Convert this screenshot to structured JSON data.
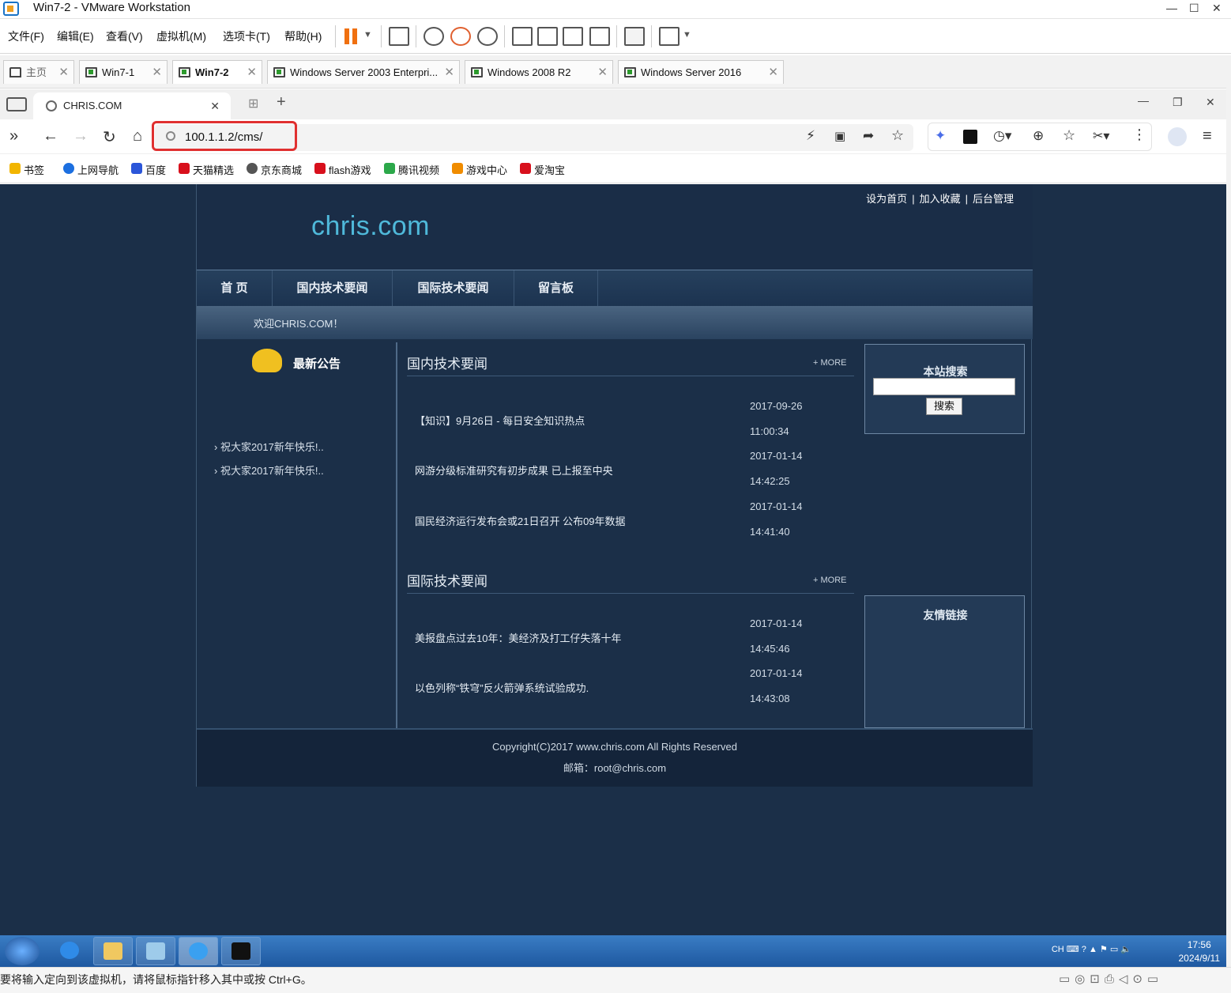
{
  "vmware": {
    "title": "Win7-2 - VMware Workstation",
    "menu": [
      "文件(F)",
      "编辑(E)",
      "查看(V)",
      "虚拟机(M)",
      "选项卡(T)",
      "帮助(H)"
    ],
    "tabs": [
      {
        "label": "主页",
        "icon": "home-icon"
      },
      {
        "label": "Win7-1",
        "icon": "vm-icon"
      },
      {
        "label": "Win7-2",
        "icon": "vm-icon",
        "active": true
      },
      {
        "label": "Windows Server 2003 Enterpri...",
        "icon": "vm-icon"
      },
      {
        "label": "Windows 2008 R2",
        "icon": "vm-icon"
      },
      {
        "label": "Windows Server 2016",
        "icon": "vm-icon"
      }
    ],
    "status_text": "要将输入定向到该虚拟机，请将鼠标指针移入其中或按 Ctrl+G。"
  },
  "browser": {
    "tab_title": "CHRIS.COM",
    "address": "100.1.1.2/cms/",
    "bookmarks": [
      {
        "label": "书签",
        "color": "#f2b500"
      },
      {
        "label": "上网导航",
        "color": "#1c6fe0"
      },
      {
        "label": "百度",
        "color": "#2b56d9"
      },
      {
        "label": "天猫精选",
        "color": "#d8101c"
      },
      {
        "label": "京东商城",
        "color": "#555555"
      },
      {
        "label": "flash游戏",
        "color": "#d8101c"
      },
      {
        "label": "腾讯视频",
        "color": "#2ca84a"
      },
      {
        "label": "游戏中心",
        "color": "#f08c00"
      },
      {
        "label": "爱淘宝",
        "color": "#d8101c"
      }
    ]
  },
  "site": {
    "top_links": [
      "设为首页",
      "加入收藏",
      "后台管理"
    ],
    "logo": "chris.com",
    "nav": [
      "首 页",
      "国内技术要闻",
      "国际技术要闻",
      "留言板"
    ],
    "welcome": "欢迎CHRIS.COM！",
    "announce_title": "最新公告",
    "announcements": [
      "祝大家2017新年快乐!..",
      "祝大家2017新年快乐!.."
    ],
    "more": "+ MORE",
    "domestic": {
      "title": "国内技术要闻",
      "items": [
        {
          "title": "【知识】9月26日 - 每日安全知识热点",
          "date": "2017-09-26",
          "time": "11:00:34"
        },
        {
          "title": "网游分级标准研究有初步成果 已上报至中央",
          "date": "2017-01-14",
          "time": "14:42:25"
        },
        {
          "title": "国民经济运行发布会或21日召开 公布09年数据",
          "date": "2017-01-14",
          "time": "14:41:40"
        }
      ]
    },
    "international": {
      "title": "国际技术要闻",
      "items": [
        {
          "title": "美报盘点过去10年：美经济及打工仔失落十年",
          "date": "2017-01-14",
          "time": "14:45:46"
        },
        {
          "title": "以色列称“铁穹”反火箭弹系统试验成功.",
          "date": "2017-01-14",
          "time": "14:43:08"
        }
      ]
    },
    "search": {
      "title": "本站搜索",
      "button": "搜索",
      "value": ""
    },
    "links_title": "友情链接",
    "footer_line1": "Copyright(C)2017 www.chris.com All Rights Reserved",
    "footer_line2": "邮箱：root@chris.com"
  },
  "taskbar": {
    "ime": "CH",
    "time": "17:56",
    "date": "2024/9/11"
  }
}
